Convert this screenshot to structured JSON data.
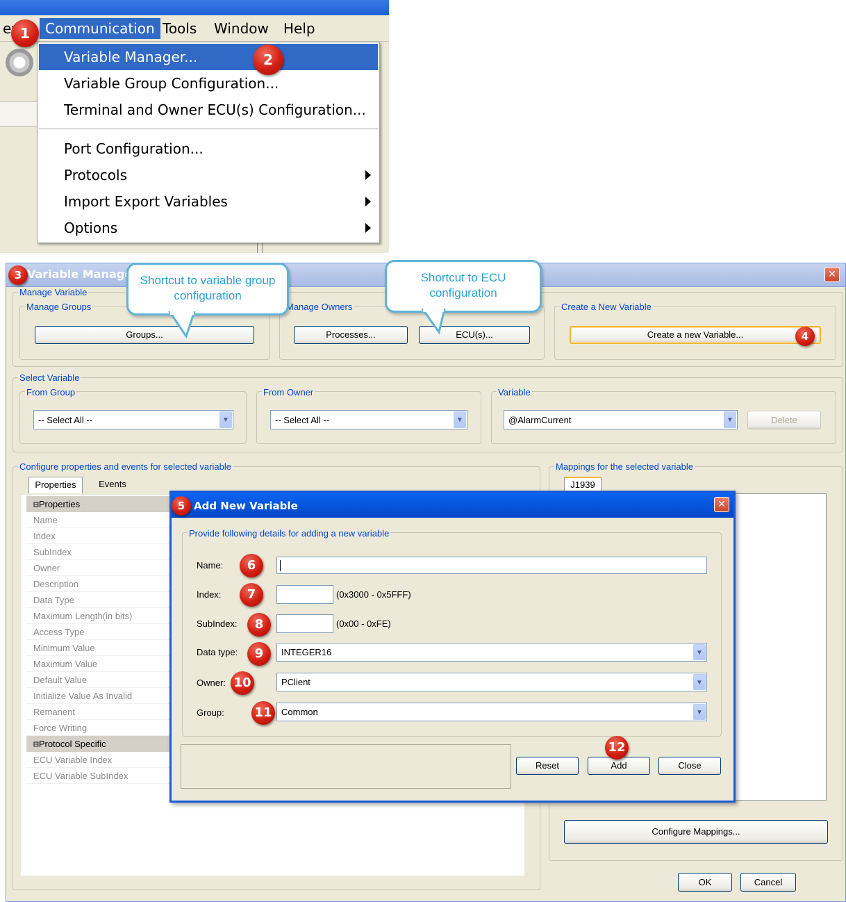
{
  "menu": {
    "menubar": [
      "ew",
      "Communication",
      "Tools",
      "Window",
      "Help"
    ],
    "items": [
      {
        "label": "Variable Manager...",
        "submenu": false
      },
      {
        "label": "Variable Group Configuration...",
        "submenu": false
      },
      {
        "label": "Terminal and Owner ECU(s) Configuration...",
        "submenu": false
      },
      {
        "label": "Port Configuration...",
        "submenu": false
      },
      {
        "label": "Protocols",
        "submenu": true
      },
      {
        "label": "Import Export Variables",
        "submenu": true
      },
      {
        "label": "Options",
        "submenu": true
      }
    ]
  },
  "badges": [
    "1",
    "2",
    "3",
    "4",
    "5",
    "6",
    "7",
    "8",
    "9",
    "10",
    "11",
    "12"
  ],
  "callouts": {
    "groups": "Shortcut to variable group configuration",
    "ecu": "Shortcut to ECU configuration"
  },
  "vm": {
    "title": "Variable Manager",
    "manage_variable": "Manage Variable",
    "manage_groups": "Manage Groups",
    "groups_button": "Groups...",
    "manage_owners": "Manage Owners",
    "processes_button": "Processes...",
    "ecus_button": "ECU(s)...",
    "create_section": "Create a New Variable",
    "create_button": "Create a new Variable...",
    "select_variable": "Select Variable",
    "from_group": "From Group",
    "from_group_value": "-- Select All --",
    "from_owner": "From Owner",
    "from_owner_value": "-- Select All --",
    "variable": "Variable",
    "variable_value": "@AlarmCurrent",
    "delete_button": "Delete",
    "configure_label": "Configure properties and events for selected variable",
    "tab_properties": "Properties",
    "tab_events": "Events",
    "cat_properties": "Properties",
    "properties": [
      "Name",
      "Index",
      "SubIndex",
      "Owner",
      "Description",
      "Data Type",
      "Maximum Length(in bits)",
      "Access Type",
      "Minimum Value",
      "Maximum Value",
      "Default Value",
      "Initialize Value As Invalid",
      "Remanent",
      "Force Writing"
    ],
    "cat_protocol": "Protocol Specific",
    "protocol_props": [
      "ECU Variable Index",
      "ECU Variable SubIndex"
    ],
    "mappings_label": "Mappings for the selected variable",
    "mapping_tab": "J1939",
    "configure_mappings_button": "Configure Mappings...",
    "ok_button": "OK",
    "cancel_button": "Cancel"
  },
  "dialog": {
    "title": "Add New Variable",
    "group_label": "Provide following details for adding a new variable",
    "name_label": "Name:",
    "name_value": "",
    "index_label": "Index:",
    "index_hint": "(0x3000 - 0x5FFF)",
    "subindex_label": "SubIndex:",
    "subindex_hint": "(0x00 - 0xFE)",
    "datatype_label": "Data type:",
    "datatype_value": "INTEGER16",
    "owner_label": "Owner:",
    "owner_value": "PClient",
    "group_field_label": "Group:",
    "group_value": "Common",
    "reset_button": "Reset",
    "add_button": "Add",
    "close_button": "Close"
  },
  "colors": {
    "accent": "#3169c6",
    "badge": "#d21e12",
    "callout": "#29a1d6",
    "group_label": "#0046d5"
  }
}
